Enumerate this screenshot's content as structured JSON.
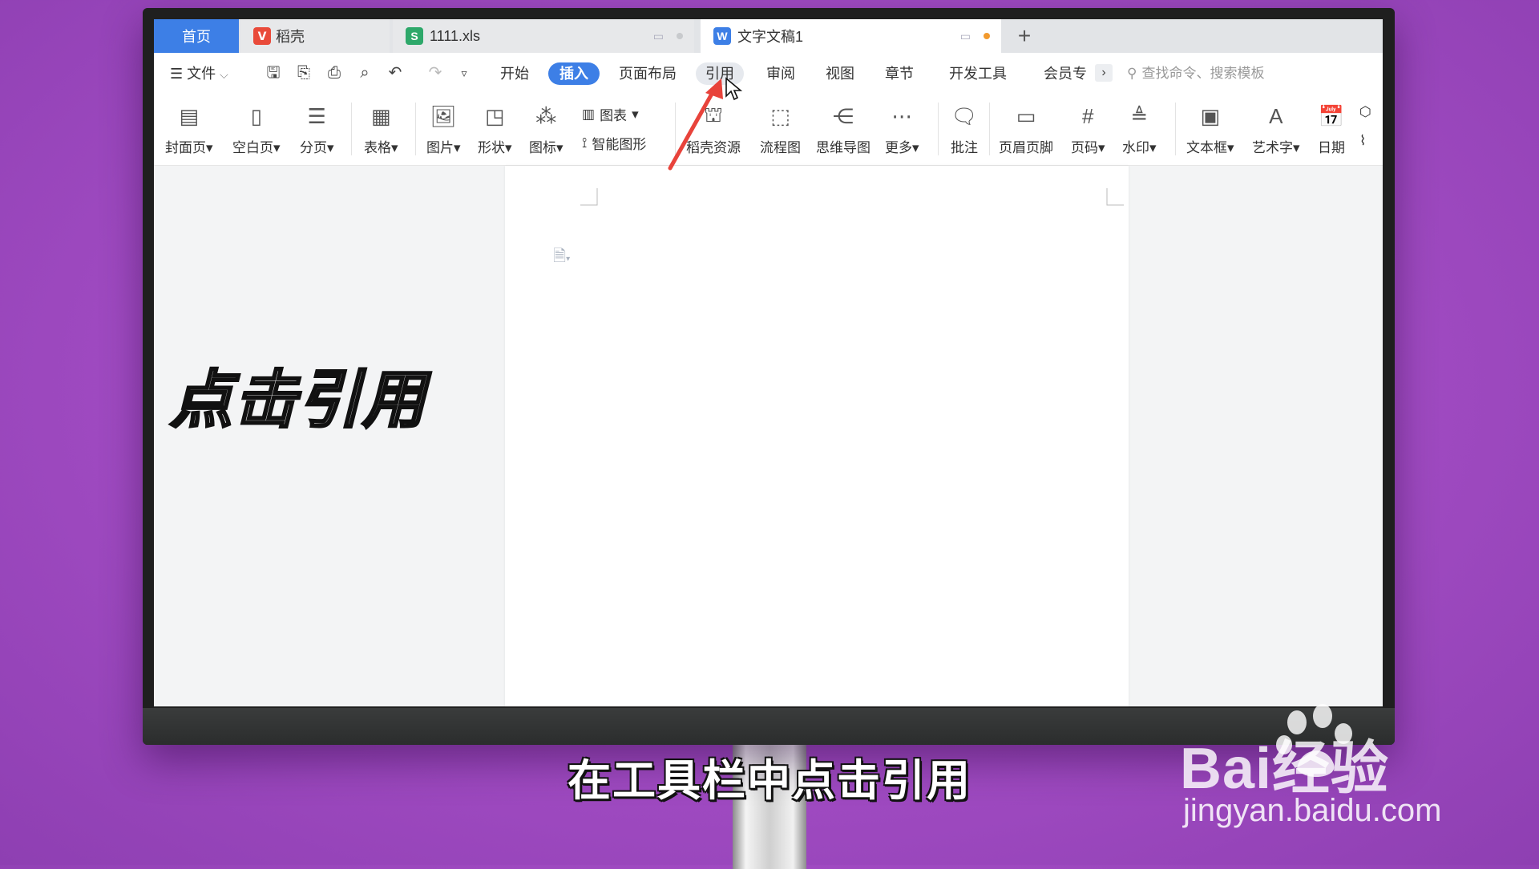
{
  "tabs": {
    "home": "首页",
    "daoke": "稻壳",
    "xls": "1111.xls",
    "doc": "文字文稿1"
  },
  "menu": {
    "file": "文件",
    "items": [
      "开始",
      "插入",
      "页面布局",
      "引用",
      "审阅",
      "视图",
      "章节",
      "开发工具",
      "会员专"
    ],
    "search_placeholder": "查找命令、搜索模板"
  },
  "ribbon": {
    "cover": "封面页",
    "blank": "空白页",
    "pagebreak": "分页",
    "table": "表格",
    "picture": "图片",
    "shape": "形状",
    "icon": "图标",
    "chart": "图表",
    "smartart": "智能图形",
    "resources": "稻壳资源",
    "flowchart": "流程图",
    "mindmap": "思维导图",
    "more": "更多",
    "comment": "批注",
    "header_footer": "页眉页脚",
    "page_number": "页码",
    "watermark": "水印",
    "textbox": "文本框",
    "wordart": "艺术字",
    "date": "日期"
  },
  "overlay": {
    "big_caption": "点击引用",
    "subtitle": "在工具栏中点击引用",
    "watermark_brand": "Bai经验",
    "watermark_url": "jingyan.baidu.com"
  },
  "colors": {
    "accent": "#3d7fe6",
    "background": "#a54ec6",
    "arrow": "#e8433b"
  }
}
